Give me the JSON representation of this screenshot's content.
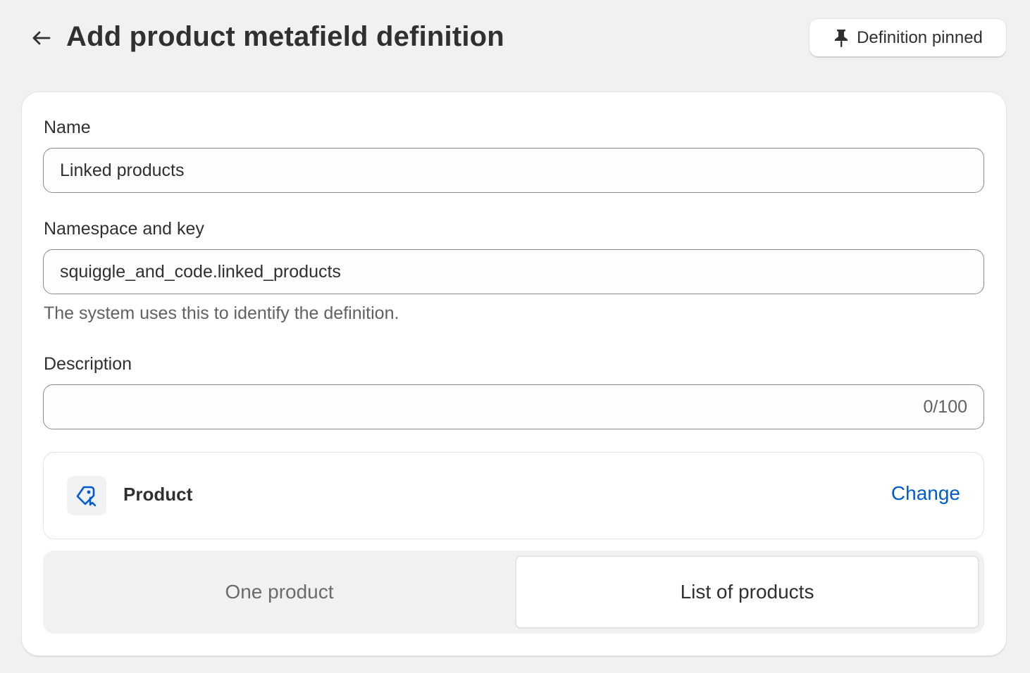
{
  "header": {
    "title": "Add product metafield definition",
    "back_icon": "arrow-left-icon",
    "pin_button": {
      "label": "Definition pinned",
      "icon": "pin-icon"
    }
  },
  "form": {
    "name": {
      "label": "Name",
      "value": "Linked products"
    },
    "namespace_key": {
      "label": "Namespace and key",
      "value": "squiggle_and_code.linked_products",
      "help": "The system uses this to identify the definition."
    },
    "description": {
      "label": "Description",
      "value": "",
      "counter": "0/100"
    },
    "type": {
      "icon": "product-tag-icon",
      "label": "Product",
      "change_label": "Change"
    },
    "cardinality": {
      "options": [
        "One product",
        "List of products"
      ],
      "selected": "List of products"
    }
  },
  "colors": {
    "accent_link": "#005bd3",
    "background": "#f1f1f1"
  }
}
